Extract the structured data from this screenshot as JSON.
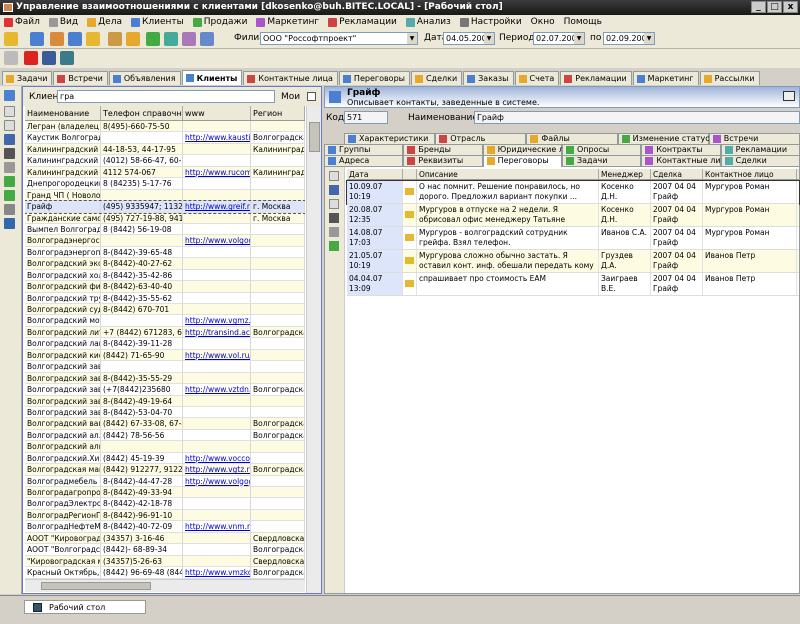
{
  "window": {
    "title": "Управление взаимоотношениями с клиентами [dkosenko@buh.BITEC.LOCAL] - [Рабочий стол]",
    "controls": [
      "_",
      "□",
      "x"
    ]
  },
  "menu": [
    {
      "label": "Файл",
      "color": "#d33"
    },
    {
      "label": "Вид",
      "color": "#999"
    },
    {
      "label": "Дела",
      "color": "#e6a92c"
    },
    {
      "label": "Клиенты",
      "color": "#4a7fd1"
    },
    {
      "label": "Продажи",
      "color": "#4a4"
    },
    {
      "label": "Маркетинг",
      "color": "#a5c"
    },
    {
      "label": "Рекламации",
      "color": "#c44"
    },
    {
      "label": "Анализ",
      "color": "#5aa"
    },
    {
      "label": "Настройки",
      "color": "#777"
    },
    {
      "label": "Окно",
      "color": ""
    },
    {
      "label": "Помощь",
      "color": ""
    }
  ],
  "toolbar": {
    "filial_label": "Филиал",
    "filial_value": "ООО \"Россофтпроект\"",
    "date_label": "Дата",
    "date_value": "04.05.2008",
    "period_label": "Период с",
    "period_from": "02.07.2007",
    "to_label": "по",
    "period_to": "02.09.2007"
  },
  "tabs": [
    {
      "label": "Задачи",
      "color": "#e6a92c"
    },
    {
      "label": "Встречи",
      "color": "#c44"
    },
    {
      "label": "Объявления",
      "color": "#4a7fd1"
    },
    {
      "label": "Клиенты",
      "color": "#4a7fd1",
      "active": true
    },
    {
      "label": "Контактные лица",
      "color": "#c44"
    },
    {
      "label": "Переговоры",
      "color": "#4a7fd1"
    },
    {
      "label": "Сделки",
      "color": "#e6a92c"
    },
    {
      "label": "Заказы",
      "color": "#4a7fd1"
    },
    {
      "label": "Счета",
      "color": "#e6a92c"
    },
    {
      "label": "Рекламации",
      "color": "#c44"
    },
    {
      "label": "Маркетинг",
      "color": "#4a7fd1"
    },
    {
      "label": "Рассылки",
      "color": "#e6a92c"
    }
  ],
  "left": {
    "client_label": "Клиент",
    "client_value": "гра",
    "moi_label": "Мои",
    "columns": [
      "Наименование",
      "Телефон справочный",
      "www",
      "Регион"
    ],
    "rows": [
      [
        "Легран (владелец О...",
        "8(495)-660-75-50",
        "",
        ""
      ],
      [
        "Каустик Волгоград",
        "",
        "http://www.kaustik.ru",
        "Волгоградская об"
      ],
      [
        "Калининградский Ж...",
        "44-18-53, 44-17-95",
        "",
        "Калининградская"
      ],
      [
        "Калининградский Ж...",
        "(4012) 58-66-47, 60-67-69",
        "",
        ""
      ],
      [
        "Калининградский за...",
        "4112  574-067",
        "http://www.rucompar",
        "Калининградская"
      ],
      [
        "Днепрогородецкий ...",
        "8 (84235) 5-17-76",
        "",
        ""
      ],
      [
        "Гранд ЧП ( Новолок...",
        "",
        "",
        ""
      ],
      [
        "Грайф",
        "(495) 9335947; 1132233",
        "http://www.greif.ru/ru",
        "г. Москва"
      ],
      [
        "Гражданские самол...",
        "(495) 727-19-88, 941-74-...",
        "",
        "г. Москва"
      ],
      [
        "Вымпел Волгоград",
        "8 (8442) 56-19-08",
        "",
        ""
      ],
      [
        "Волгоградэнергосбыт",
        "",
        "http://www.volgogradenergi",
        ""
      ],
      [
        "Волгоградэнергопрон",
        "8-(8442)-39-65-48",
        "",
        ""
      ],
      [
        "Волгоградский эксп...",
        "8-(8442)-40-27-62",
        "",
        ""
      ],
      [
        "Волгоградский холд...",
        "8-(8442)-35-42-86",
        "",
        ""
      ],
      [
        "Волгоградский фили...",
        "8-(8442)-63-40-40",
        "",
        ""
      ],
      [
        "Волгоградский труб...",
        "8-(8442)-35-55-62",
        "",
        ""
      ],
      [
        "Волгоградский судо...",
        "8-(8442) 670-701",
        "",
        ""
      ],
      [
        "Волгоградский мото...",
        "",
        "http://www.vgmz.ru",
        ""
      ],
      [
        "Волгоградский лите...",
        "+7 (8442) 671283, 670117",
        "http://transind.actinfo",
        "Волгоградская об"
      ],
      [
        "Волгоградский лако...",
        "8-(8442)-39-11-28",
        "",
        ""
      ],
      [
        "Волгоградский кисл...",
        "(8442) 71-65-90",
        "http://www.vol.ru/cor",
        ""
      ],
      [
        "Волгоградский заво...",
        "",
        "",
        ""
      ],
      [
        "Волгоградский заво...",
        "8-(8442)-35-55-29",
        "",
        ""
      ],
      [
        "Волгоградский заво...",
        "(+7(8442)235680",
        "http://www.vztdn.ru",
        "Волгоградская об"
      ],
      [
        "Волгоградский заво...",
        "8-(8442)-49-19-64",
        "",
        ""
      ],
      [
        "Волгоградский заво...",
        "8-(8442)-53-04-70",
        "",
        ""
      ],
      [
        "Волгоградский ваго...",
        "(8442) 67-33-08, 67-43-89",
        "",
        "Волгоградская об"
      ],
      [
        "Волгоградский ал...",
        "(8442) 78-56-56",
        "",
        "Волгоградская об"
      ],
      [
        "Волгоградский алю...",
        "",
        "",
        ""
      ],
      [
        "Волгоградский.Хим...",
        "(8442) 45-19-39",
        "http://www.vocco.ru",
        ""
      ],
      [
        "Волгоградская маш...",
        "(8442) 912277, 912288,...",
        "http://www.vgtz.ru/co",
        "Волгоградская об"
      ],
      [
        "Волгоградмебель",
        "8-(8442)-44-47-28",
        "http://www.volgograc",
        ""
      ],
      [
        "Волгоградагропром...",
        "8-(8442)-49-33-94",
        "",
        ""
      ],
      [
        "ВолгоградЭлектрон...",
        "8-(8442)-42-18-78",
        "",
        ""
      ],
      [
        "ВолгоградРегионГаз",
        "8-(8442)-96-91-10",
        "",
        ""
      ],
      [
        "ВолгоградНефтеМаш",
        "8-(8442)-40-72-09",
        "http://www.vnm.ru",
        ""
      ],
      [
        "АООТ \"Кировоград...",
        "(34357) 3-16-46",
        "",
        "Свердловская обл"
      ],
      [
        "АООТ \"Волгоградск...",
        "(8442)- 68-89-34",
        "",
        "Волгоградская об"
      ],
      [
        "\"Кировоградская ме...",
        "(34357)5-26-63",
        "",
        "Свердловская обл"
      ],
      [
        "Красный Октябрь, В...",
        "(8442) 96-69-48 (8442) 5...",
        "http://www.vmzko.ru",
        "Волгоградская об"
      ]
    ]
  },
  "right": {
    "name": "Грайф",
    "subtitle": "Описывает контакты, заведенные в системе.",
    "code_label": "Код",
    "code_value": "571",
    "name_label": "Наименование",
    "name_value": "Грайф",
    "subtabs_row1": [
      "Характеристики",
      "Отрасль",
      "Файлы",
      "Изменение статуса",
      "Встречи"
    ],
    "subtabs_row2": [
      "Группы",
      "Бренды",
      "Юридические лица",
      "Опросы",
      "Контракты",
      "Рекламации"
    ],
    "subtabs_row3": [
      "Адреса",
      "Реквизиты",
      "Переговоры",
      "Задачи",
      "Контактные лица",
      "Сделки"
    ],
    "conv_columns": [
      "Дата",
      "",
      "Описание",
      "Менеджер",
      "Сделка",
      "Контактное лицо"
    ],
    "conv_rows": [
      [
        "10.09.07 10:19",
        "",
        "О нас помнит. Решение понравилось, но дорого. Предложил вариант покупки ...",
        "Косенко Д.Н.",
        "2007 04 04 Грайф",
        "Мургуров Роман"
      ],
      [
        "20.08.07 12:35",
        "",
        "Мургуров в отпуске на 2 недели. Я обрисовал офис менеджеру Татьяне ситуацию, сказал...",
        "Косенко Д.Н.",
        "2007 04 04 Грайф",
        "Мургуров Роман"
      ],
      [
        "14.08.07 17:03",
        "",
        "Мургуров - волгоградский сотрудник грейфа. Взял телефон.",
        "Иванов С.А.",
        "2007 04 04 Грайф",
        "Мургуров Роман"
      ],
      [
        "21.05.07 10:19",
        "",
        "Мургурова сложно обычно застать. Я оставил конт. инф. обешали передать кому нужно...",
        "Груздев Д.А.",
        "2007 04 04 Грайф",
        "Иванов Петр"
      ],
      [
        "04.04.07 13:09",
        "",
        "спрашивает про стоимость ЕАМ",
        "Заиграев В.Е.",
        "2007 04 04 Грайф",
        "Иванов Петр"
      ]
    ]
  },
  "status": {
    "task_label": "Рабочий стол"
  }
}
